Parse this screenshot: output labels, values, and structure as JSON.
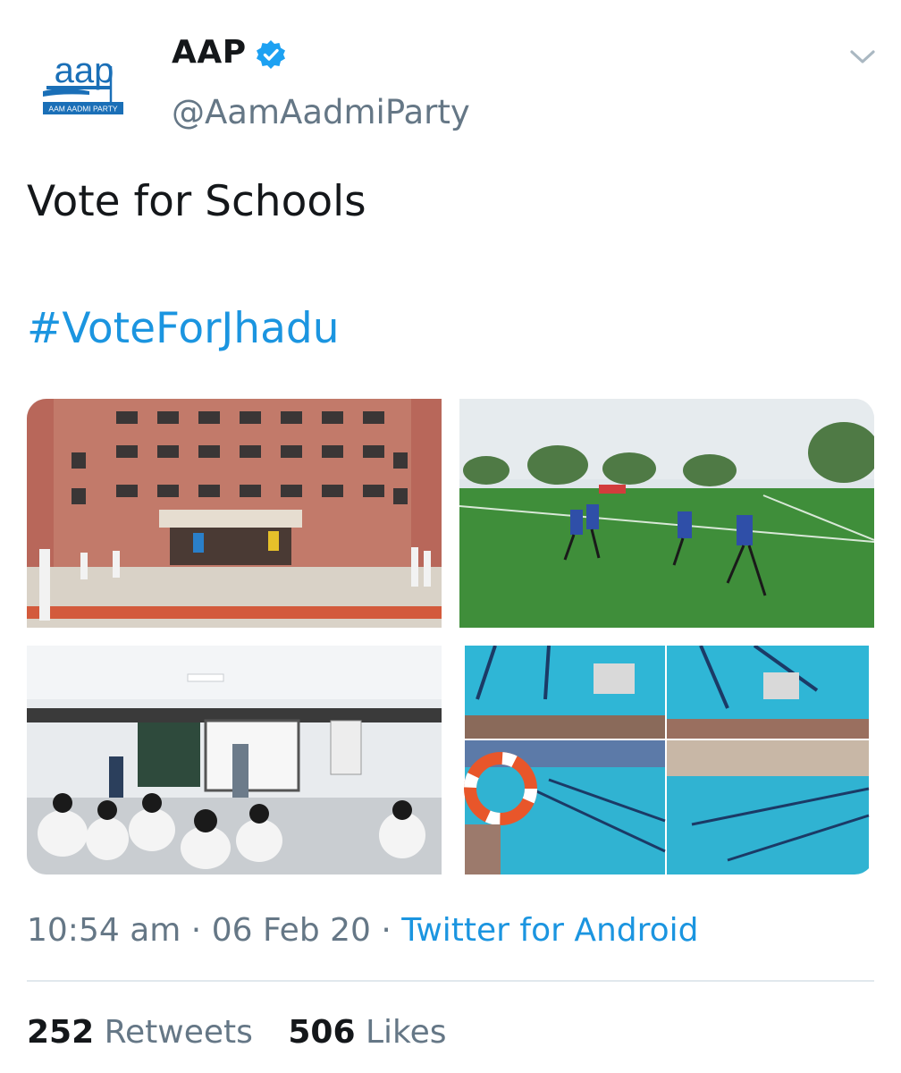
{
  "author": {
    "display_name": "AAP",
    "handle": "@AamAadmiParty",
    "verified": true,
    "avatar": {
      "logo_text": "aap",
      "logo_subtext": "AAM AADMI PARTY",
      "icon": "aap-logo-icon"
    }
  },
  "tweet": {
    "text": "Vote for Schools",
    "hashtag": "#VoteForJhadu"
  },
  "media": [
    {
      "name": "school-building-photo",
      "icon": "photo"
    },
    {
      "name": "hockey-field-photo",
      "icon": "photo"
    },
    {
      "name": "smart-classroom-photo",
      "icon": "photo"
    },
    {
      "name": "swimming-pool-photo",
      "icon": "photo"
    }
  ],
  "meta": {
    "time": "10:54 am",
    "separator": "·",
    "date": "06 Feb 20",
    "source": "Twitter for Android"
  },
  "stats": {
    "retweets_count": "252",
    "retweets_label": "Retweets",
    "likes_count": "506",
    "likes_label": "Likes"
  },
  "colors": {
    "link": "#1b95e0",
    "secondary_text": "#657786",
    "primary_text": "#14171a",
    "divider": "#e1e8ed",
    "brand_blue": "#1a6fb7"
  }
}
